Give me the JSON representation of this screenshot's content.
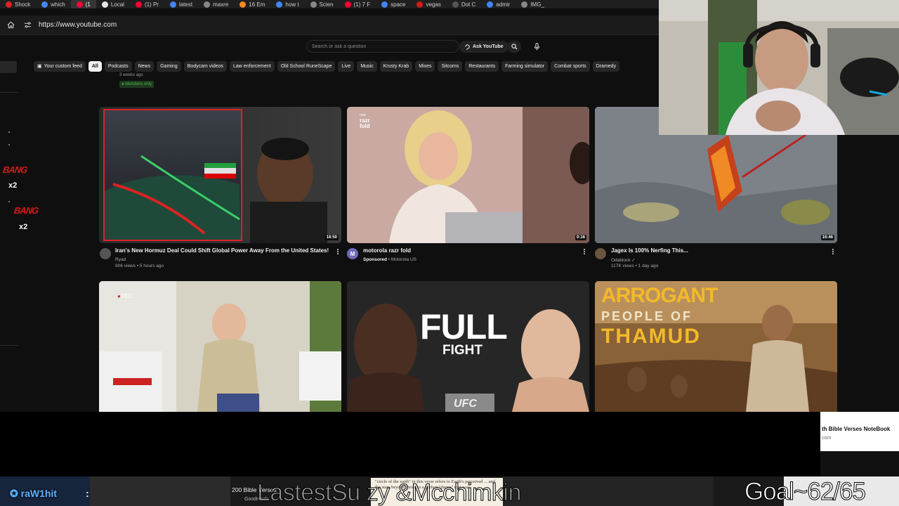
{
  "browser": {
    "tabs": [
      {
        "label": "Shock",
        "icon": "news-favicon",
        "color": "#d22"
      },
      {
        "label": "which",
        "icon": "google-favicon",
        "color": "#4285f4"
      },
      {
        "label": "(1",
        "icon": "youtube-favicon",
        "color": "#ff0033",
        "active": true
      },
      {
        "label": "Local",
        "icon": "app-favicon",
        "color": "#e6e6e6"
      },
      {
        "label": "(1) Pr",
        "icon": "youtube-favicon",
        "color": "#ff0033"
      },
      {
        "label": "latest",
        "icon": "google-favicon",
        "color": "#4285f4"
      },
      {
        "label": "maxre",
        "icon": "page-favicon",
        "color": "#888888"
      },
      {
        "label": "16 Em",
        "icon": "orange-favicon",
        "color": "#f08a24"
      },
      {
        "label": "how t",
        "icon": "google-favicon",
        "color": "#4285f4"
      },
      {
        "label": "Scien",
        "icon": "page-favicon",
        "color": "#888888"
      },
      {
        "label": "(1) 7 F",
        "icon": "youtube-favicon",
        "color": "#ff0033"
      },
      {
        "label": "space",
        "icon": "google-favicon",
        "color": "#4285f4"
      },
      {
        "label": "vegas",
        "icon": "red-favicon",
        "color": "#d11b1b"
      },
      {
        "label": "Dot C",
        "icon": "dark-favicon",
        "color": "#555555"
      },
      {
        "label": "admir",
        "icon": "google-favicon",
        "color": "#4285f4"
      },
      {
        "label": "IMG_",
        "icon": "page-favicon",
        "color": "#888888"
      }
    ],
    "url": "https://www.youtube.com"
  },
  "youtube": {
    "search_placeholder": "Search or ask a question",
    "ask_label": "Ask YouTube",
    "chips": [
      {
        "label": "Your custom feed",
        "custom": true
      },
      {
        "label": "All",
        "active": true
      },
      {
        "label": "Podcasts"
      },
      {
        "label": "News"
      },
      {
        "label": "Gaming"
      },
      {
        "label": "Bodycam videos"
      },
      {
        "label": "Law enforcement"
      },
      {
        "label": "Old School RuneScape"
      },
      {
        "label": "Live"
      },
      {
        "label": "Music"
      },
      {
        "label": "Krusty Krab"
      },
      {
        "label": "Mixes"
      },
      {
        "label": "Sitcoms"
      },
      {
        "label": "Restaurants"
      },
      {
        "label": "Farming simulator"
      },
      {
        "label": "Combat sports"
      },
      {
        "label": "Dramedy"
      }
    ],
    "prev_row": {
      "meta": "3 weeks ago",
      "badge": "Members only"
    },
    "videos": [
      {
        "title": "Iran's New Hormuz Deal Could Shift Global Power Away From the United States!",
        "channel": "Ryad",
        "meta": "906 views • 5 hours ago",
        "duration": "18:50"
      },
      {
        "title": "motorola razr fold",
        "channel": "Motorola US",
        "sponsored_label": "Sponsored",
        "meta": "Sponsored • Motorola US",
        "duration": "0:16",
        "overlay_brand": "razr fold",
        "overlay_small": "new"
      },
      {
        "title": "Jagex Is 100% Nerfing This...",
        "channel": "Odablock",
        "meta": "117K views • 1 day ago",
        "duration": "16:46"
      },
      {
        "rec_label": "REC"
      },
      {
        "overlay_line1": "FULL",
        "overlay_line2": "FIGHT",
        "overlay_logo": "UFC"
      },
      {
        "overlay_line1": "ARROGANT",
        "overlay_line2": "PEOPLE OF",
        "overlay_line3": "THAMUD"
      }
    ]
  },
  "overlays": {
    "alert1": "BANG",
    "alert1_mult": "x2",
    "alert2": "BANG",
    "alert2_mult": "x2"
  },
  "popup": {
    "title": "th Bible Verses NoteBook",
    "sub": "com"
  },
  "ticker": {
    "user": "raW1hit",
    "colon": ":",
    "book_title": "200 Bible Verses",
    "book_source": "Goodreads",
    "main_text": "LastestSu          zy &Mcchimkin",
    "quote": "\"circle of the earth\" in this verse refers to Earth's perceived ... and the stars beyond move in a perfect \"dance\" that was",
    "goal": "Goal~62/65"
  }
}
